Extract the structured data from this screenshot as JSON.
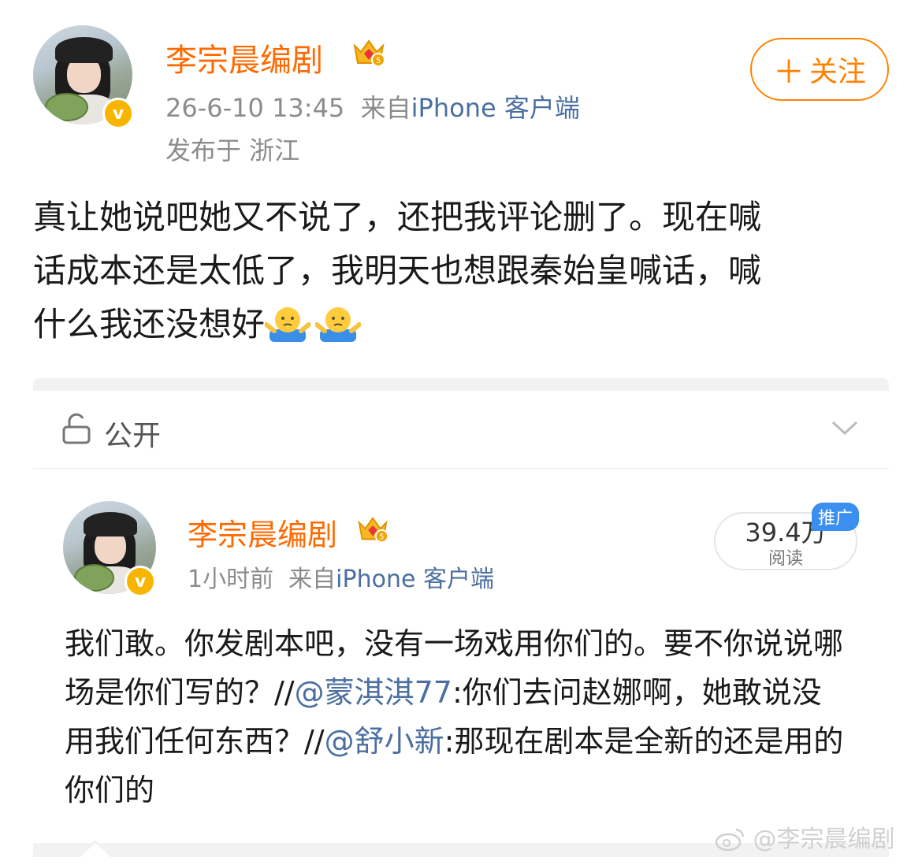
{
  "post": {
    "username": "李宗晨编剧",
    "timestamp": "26-6-10 13:45",
    "source_prefix": "来自",
    "source": "iPhone 客户端",
    "location": "发布于 浙江",
    "follow_label": "关注",
    "text_lines": [
      "真让她说吧她又不说了，还把我评论删了。现在喊",
      "话成本还是太低了，我明天也想跟秦始皇喊话，喊",
      "什么我还没想好"
    ],
    "emoji_icons": [
      "shrug-emoji",
      "shrug-emoji"
    ]
  },
  "visibility": {
    "label": "公开",
    "icon": "unlock-icon"
  },
  "repost": {
    "username": "李宗晨编剧",
    "time": "1小时前",
    "source_prefix": "来自",
    "source": "iPhone 客户端",
    "reads_value": "39.4万",
    "reads_label": "阅读",
    "promo_label": "推广",
    "text": {
      "part1": "我们敢。你发剧本吧，没有一场戏用你们的。要不你说说哪场是你们写的？//",
      "mention1": "@蒙淇淇77",
      "part2": ":你们去问赵娜啊，她敢说没用我们任何东西？//",
      "mention2": "@舒小新",
      "part3": ":那现在剧本是全新的还是用的你们的"
    }
  },
  "watermark": "@李宗晨编剧",
  "colors": {
    "username": "#ff6a00",
    "follow": "#ff8200",
    "link": "#4b6fa0",
    "verified": "#f7b500",
    "promo": "#3b8ff0"
  }
}
